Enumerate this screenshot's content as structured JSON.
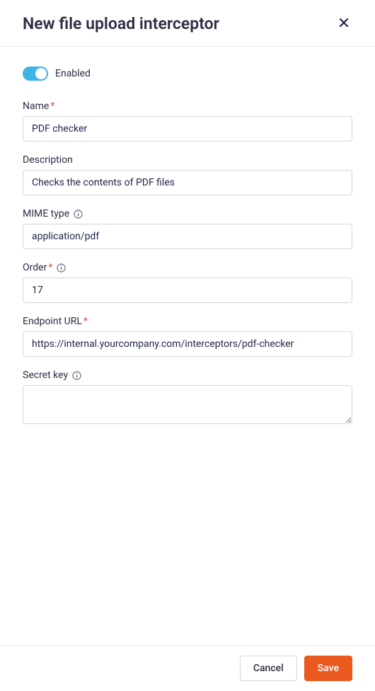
{
  "header": {
    "title": "New file upload interceptor"
  },
  "toggle": {
    "label": "Enabled",
    "on": true
  },
  "fields": {
    "name": {
      "label": "Name",
      "required": true,
      "value": "PDF checker"
    },
    "description": {
      "label": "Description",
      "value": "Checks the contents of PDF files"
    },
    "mime_type": {
      "label": "MIME type",
      "value": "application/pdf"
    },
    "order": {
      "label": "Order",
      "required": true,
      "value": "17"
    },
    "endpoint_url": {
      "label": "Endpoint URL",
      "required": true,
      "value": "https://internal.yourcompany.com/interceptors/pdf-checker"
    },
    "secret_key": {
      "label": "Secret key",
      "value": ""
    }
  },
  "footer": {
    "cancel": "Cancel",
    "save": "Save"
  }
}
